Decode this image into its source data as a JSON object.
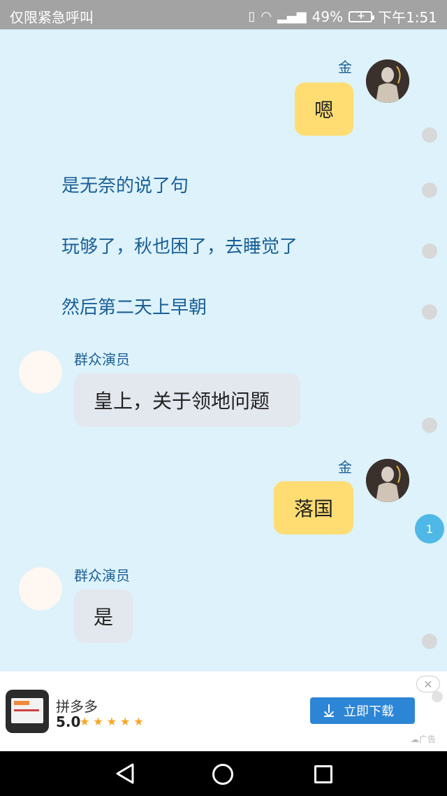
{
  "status_bar": {
    "carrier": "仅限紧急呼叫",
    "battery": "49%",
    "time": "下午1:51"
  },
  "chat": {
    "messages": [
      {
        "type": "bubble",
        "side": "right",
        "sender": "金",
        "text": "嗯"
      },
      {
        "type": "narration",
        "text": "是无奈的说了句"
      },
      {
        "type": "narration",
        "text": "玩够了，秋也困了，去睡觉了"
      },
      {
        "type": "narration",
        "text": "然后第二天上早朝"
      },
      {
        "type": "bubble",
        "side": "left",
        "sender": "群众演员",
        "text": "皇上，关于领地问题"
      },
      {
        "type": "bubble",
        "side": "right",
        "sender": "金",
        "text": "落国"
      },
      {
        "type": "bubble",
        "side": "left",
        "sender": "群众演员",
        "text": "是"
      }
    ],
    "unread_badge": "1"
  },
  "ad": {
    "app_name": "拼多多",
    "rating": "5.0",
    "stars": 5,
    "button_label": "立即下载",
    "close_symbol": "✕",
    "tag": "广告"
  },
  "colors": {
    "background": "#ddf2fb",
    "self_bubble": "#ffdd73",
    "other_bubble": "#e3e7ee",
    "name_text": "#1a5f96",
    "download_button": "#2d85d6"
  }
}
